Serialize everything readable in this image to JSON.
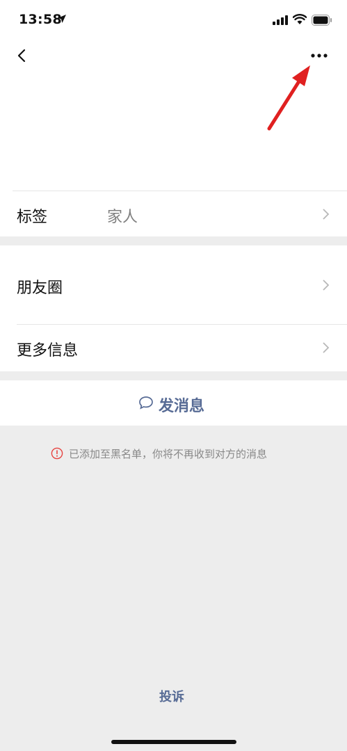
{
  "status_bar": {
    "time": "13:58"
  },
  "rows": {
    "tag": {
      "label": "标签",
      "value": "家人"
    },
    "moments": {
      "label": "朋友圈"
    },
    "more_info": {
      "label": "更多信息"
    }
  },
  "actions": {
    "send_message": "发消息",
    "complain": "投诉"
  },
  "notice": {
    "blocked_text": "已添加至黑名单，你将不再收到对方的消息"
  },
  "colors": {
    "link": "#576b95",
    "annotation_arrow": "#e02020",
    "warning": "#e64340"
  }
}
